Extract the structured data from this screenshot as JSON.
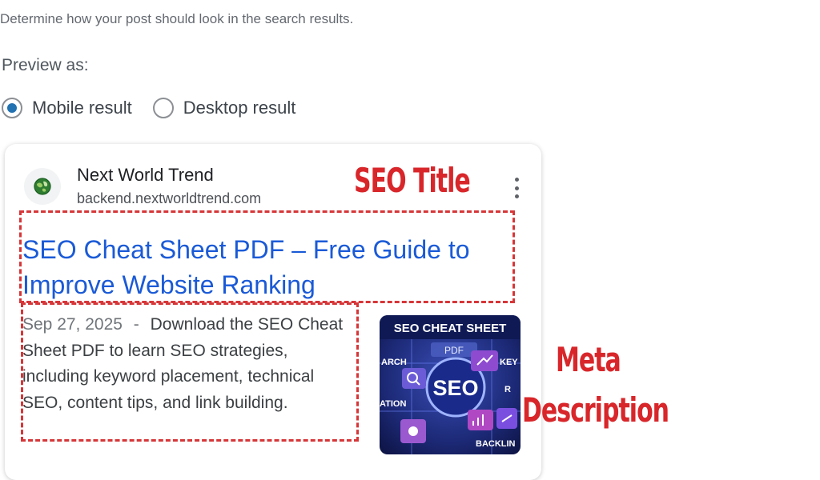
{
  "intro_text": "Determine how your post should look in the search results.",
  "preview_label": "Preview as:",
  "radio_options": {
    "mobile": {
      "label": "Mobile result",
      "checked": true
    },
    "desktop": {
      "label": "Desktop result",
      "checked": false
    }
  },
  "result": {
    "site_name": "Next World Trend",
    "url": "backend.nextworldtrend.com",
    "title": "SEO Cheat Sheet PDF – Free Guide to Improve Website Ranking",
    "date": "Sep 27, 2025",
    "separator": "-",
    "description": "Download the SEO Cheat Sheet PDF to learn SEO strategies, including keyword placement, technical SEO, content tips, and link building.",
    "thumbnail": {
      "heading": "SEO CHEAT SHEET",
      "sub": "PDF",
      "center": "SEO",
      "words": [
        "ARCH",
        "KEY",
        "ATION",
        "R",
        "BACKLIN"
      ]
    }
  },
  "annotations": {
    "title_label": "SEO Title",
    "meta_label_line1": "Meta",
    "meta_label_line2": "Description"
  },
  "colors": {
    "title_link": "#1a5ad7",
    "radio_accent": "#2271b1",
    "annotation_red": "#d8262a"
  }
}
